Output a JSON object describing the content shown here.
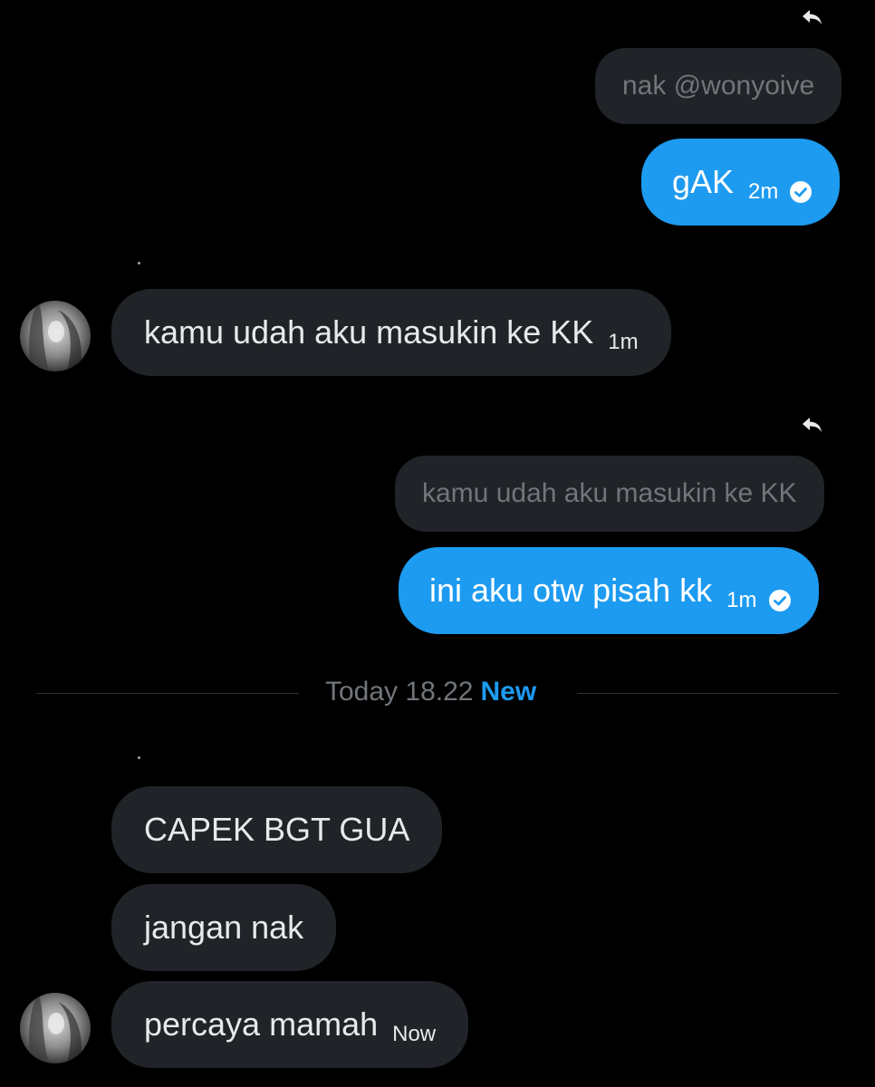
{
  "colors": {
    "background": "#000000",
    "outgoing_bubble": "#1d9bf0",
    "incoming_bubble": "#202327",
    "quote_bubble": "#202327",
    "muted_text": "#71767b",
    "accent": "#1d9bf0"
  },
  "conversation": {
    "reply_1": {
      "icon": "reply-icon",
      "quote_text": "nak @wonyoive",
      "message": "gAK",
      "time": "2m",
      "status_icon": "check-circle-icon"
    },
    "incoming_1": {
      "message": "kamu udah aku masukin ke KK",
      "time": "1m",
      "avatar": "avatar"
    },
    "reply_2": {
      "icon": "reply-icon",
      "quote_text": "kamu udah aku masukin ke KK",
      "message": "ini aku otw pisah kk",
      "time": "1m",
      "status_icon": "check-circle-icon"
    },
    "divider": {
      "date": "Today 18.22",
      "new_label": "New"
    },
    "incoming_group": [
      {
        "message": "CAPEK BGT GUA"
      },
      {
        "message": "jangan nak"
      },
      {
        "message": "percaya mamah",
        "time": "Now"
      }
    ]
  }
}
